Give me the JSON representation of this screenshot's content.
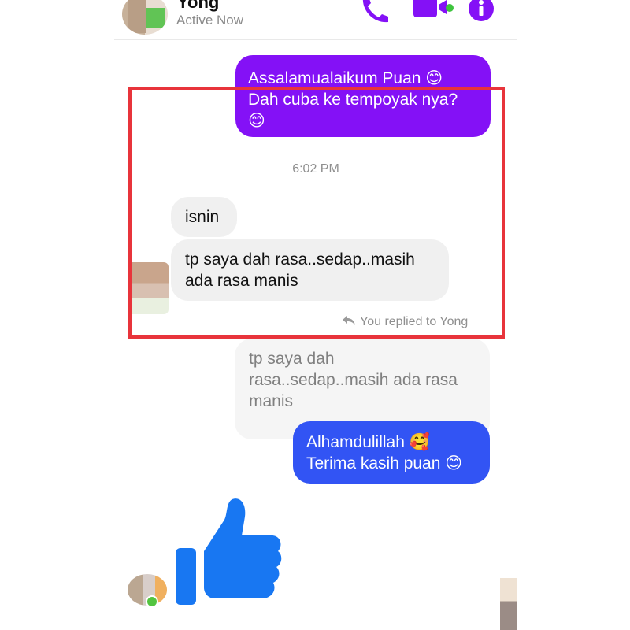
{
  "header": {
    "contact_name": "Yong",
    "status": "Active Now",
    "icons": [
      "phone-icon",
      "video-camera-icon",
      "info-icon"
    ],
    "accent_color": "#8411f6"
  },
  "messages": {
    "outgoing_1": "Assalamualaikum Puan 😊\nDah cuba ke tempoyak nya?\n😊",
    "timestamp": "6:02 PM",
    "incoming_1": "isnin",
    "incoming_2": "tp saya dah rasa..sedap..masih\nada rasa manis",
    "reply_indicator": "You replied to Yong",
    "quoted_text": "tp saya dah\nrasa..sedap..masih ada rasa\nmanis",
    "outgoing_2": "Alhamdulillah 🥰\nTerima kasih puan 😊",
    "reaction_icon": "thumbs-up-icon"
  },
  "colors": {
    "outgoing_purple": "#8411f6",
    "outgoing_blue": "#3254f4",
    "incoming_bg": "#f0f0f0",
    "highlight_border": "#e8343b",
    "like_blue": "#1877f2"
  }
}
